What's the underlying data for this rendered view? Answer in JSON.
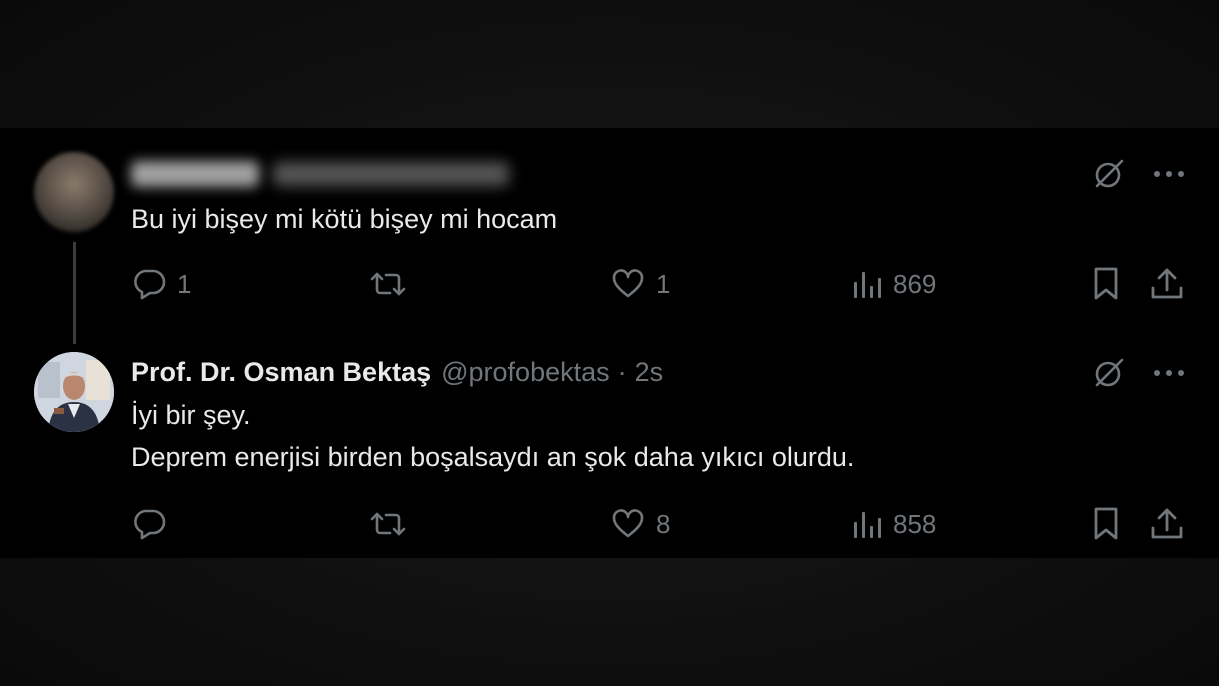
{
  "thread": {
    "reply": {
      "display_name": "",
      "handle": "",
      "text": "Bu iyi bişey mi kötü bişey mi hocam",
      "stats": {
        "replies": "1",
        "retweets": "",
        "likes": "1",
        "views": "869"
      }
    },
    "answer": {
      "display_name": "Prof. Dr. Osman Bektaş",
      "handle": "@profobektas",
      "separator": "·",
      "time": "2s",
      "text_line1": "İyi bir şey.",
      "text_line2": "Deprem enerjisi birden boşalsaydı an şok daha yıkıcı olurdu.",
      "stats": {
        "replies": "",
        "retweets": "",
        "likes": "8",
        "views": "858"
      }
    }
  },
  "icons": {
    "grok": "grok-icon",
    "more": "more-icon",
    "reply": "reply-icon",
    "retweet": "retweet-icon",
    "like": "heart-icon",
    "views": "analytics-icon",
    "bookmark": "bookmark-icon",
    "share": "share-icon"
  },
  "colors": {
    "background": "#000000",
    "text": "#e7e9ea",
    "muted": "#71767b",
    "thread_line": "#3a3d40"
  }
}
